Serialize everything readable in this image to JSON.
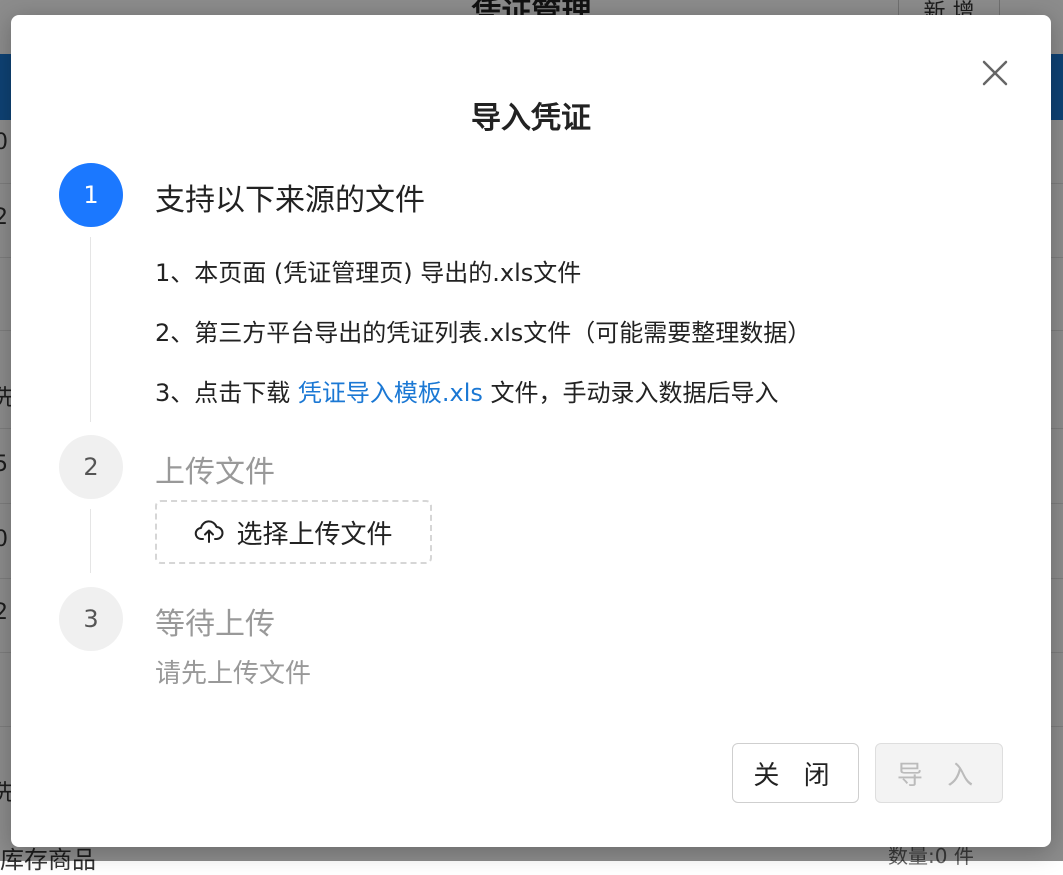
{
  "background": {
    "title": "凭证管理",
    "new_button": "新 增",
    "edge_chars": [
      "0",
      "2",
      "先",
      "5",
      "0",
      "2",
      "先"
    ],
    "footer_left": "库存商品",
    "footer_right": "数量:0 件"
  },
  "modal": {
    "title": "导入凭证",
    "steps": [
      {
        "number": "1",
        "title": "支持以下来源的文件",
        "state": "active"
      },
      {
        "number": "2",
        "title": "上传文件",
        "state": "inactive"
      },
      {
        "number": "3",
        "title": "等待上传",
        "state": "inactive"
      }
    ],
    "sources": {
      "line1": "1、本页面 (凭证管理页) 导出的.xls文件",
      "line2": "2、第三方平台导出的凭证列表.xls文件（可能需要整理数据）",
      "line3_prefix": "3、点击下载 ",
      "line3_link": "凭证导入模板.xls",
      "line3_suffix": " 文件，手动录入数据后导入"
    },
    "upload_button": "选择上传文件",
    "waiting_hint": "请先上传文件",
    "footer": {
      "close_label": "关 闭",
      "import_label": "导 入"
    }
  },
  "colors": {
    "accent": "#1b78ff",
    "link": "#1b78d4",
    "muted": "#999999"
  }
}
